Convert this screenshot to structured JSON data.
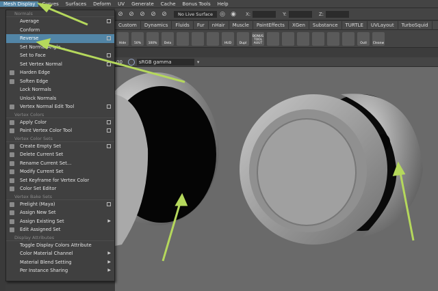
{
  "menubar": [
    "Mesh Display",
    "Curves",
    "Surfaces",
    "Deform",
    "UV",
    "Generate",
    "Cache",
    "Bonus Tools",
    "Help"
  ],
  "toolbar": {
    "live_surface": "No Live Surface",
    "x_label": "X:",
    "y_label": "Y:",
    "z_label": "Z:"
  },
  "shelf_tabs": [
    "Custom",
    "Dynamics",
    "Fluids",
    "Fur",
    "nHair",
    "Muscle",
    "PaintEffects",
    "XGen",
    "Substance",
    "TURTLE",
    "UVLayout",
    "TurboSquid"
  ],
  "shelf_buttons": [
    "Hide",
    "50%",
    "100%",
    "Dela",
    "",
    "",
    "",
    "HUD",
    "Dupl",
    "BONUS TOOL AUUT",
    "",
    "",
    "",
    "",
    "",
    "",
    "Outl",
    "Cleanw"
  ],
  "viewbar": {
    "num": "00",
    "gamma": "sRGB gamma"
  },
  "menu": [
    {
      "t": "sect",
      "label": "Normals"
    },
    {
      "t": "item",
      "label": "Average",
      "box": true
    },
    {
      "t": "item",
      "label": "Conform"
    },
    {
      "t": "item",
      "label": "Reverse",
      "box": true,
      "hl": true
    },
    {
      "t": "item",
      "label": "Set Normal Angle..."
    },
    {
      "t": "item",
      "label": "Set to Face",
      "box": true
    },
    {
      "t": "item",
      "label": "Set Vertex Normal",
      "box": true
    },
    {
      "t": "item",
      "label": "Harden Edge",
      "icon": true
    },
    {
      "t": "item",
      "label": "Soften Edge",
      "icon": true
    },
    {
      "t": "item",
      "label": "Lock Normals"
    },
    {
      "t": "item",
      "label": "Unlock Normals"
    },
    {
      "t": "item",
      "label": "Vertex Normal Edit Tool",
      "box": true,
      "icon": true
    },
    {
      "t": "sect",
      "label": "Vertex Colors"
    },
    {
      "t": "item",
      "label": "Apply Color",
      "box": true,
      "icon": true
    },
    {
      "t": "item",
      "label": "Paint Vertex Color Tool",
      "box": true,
      "icon": true
    },
    {
      "t": "sect",
      "label": "Vertex Color Sets"
    },
    {
      "t": "item",
      "label": "Create Empty Set",
      "box": true,
      "icon": true
    },
    {
      "t": "item",
      "label": "Delete Current Set",
      "icon": true
    },
    {
      "t": "item",
      "label": "Rename Current Set...",
      "icon": true
    },
    {
      "t": "item",
      "label": "Modify Current Set",
      "icon": true
    },
    {
      "t": "item",
      "label": "Set Keyframe for Vertex Color",
      "icon": true
    },
    {
      "t": "item",
      "label": "Color Set Editor",
      "icon": true
    },
    {
      "t": "sect",
      "label": "Vertex Bake Sets"
    },
    {
      "t": "item",
      "label": "Prelight (Maya)",
      "box": true,
      "icon": true
    },
    {
      "t": "item",
      "label": "Assign New Set",
      "icon": true
    },
    {
      "t": "item",
      "label": "Assign Existing Set",
      "arrow": true,
      "icon": true
    },
    {
      "t": "item",
      "label": "Edit Assigned Set",
      "icon": true
    },
    {
      "t": "sect",
      "label": "Display Attributes"
    },
    {
      "t": "item",
      "label": "Toggle Display Colors Attribute"
    },
    {
      "t": "item",
      "label": "Color Material Channel",
      "arrow": true
    },
    {
      "t": "item",
      "label": "Material Blend Setting",
      "arrow": true
    },
    {
      "t": "item",
      "label": "Per Instance Sharing",
      "arrow": true
    }
  ]
}
